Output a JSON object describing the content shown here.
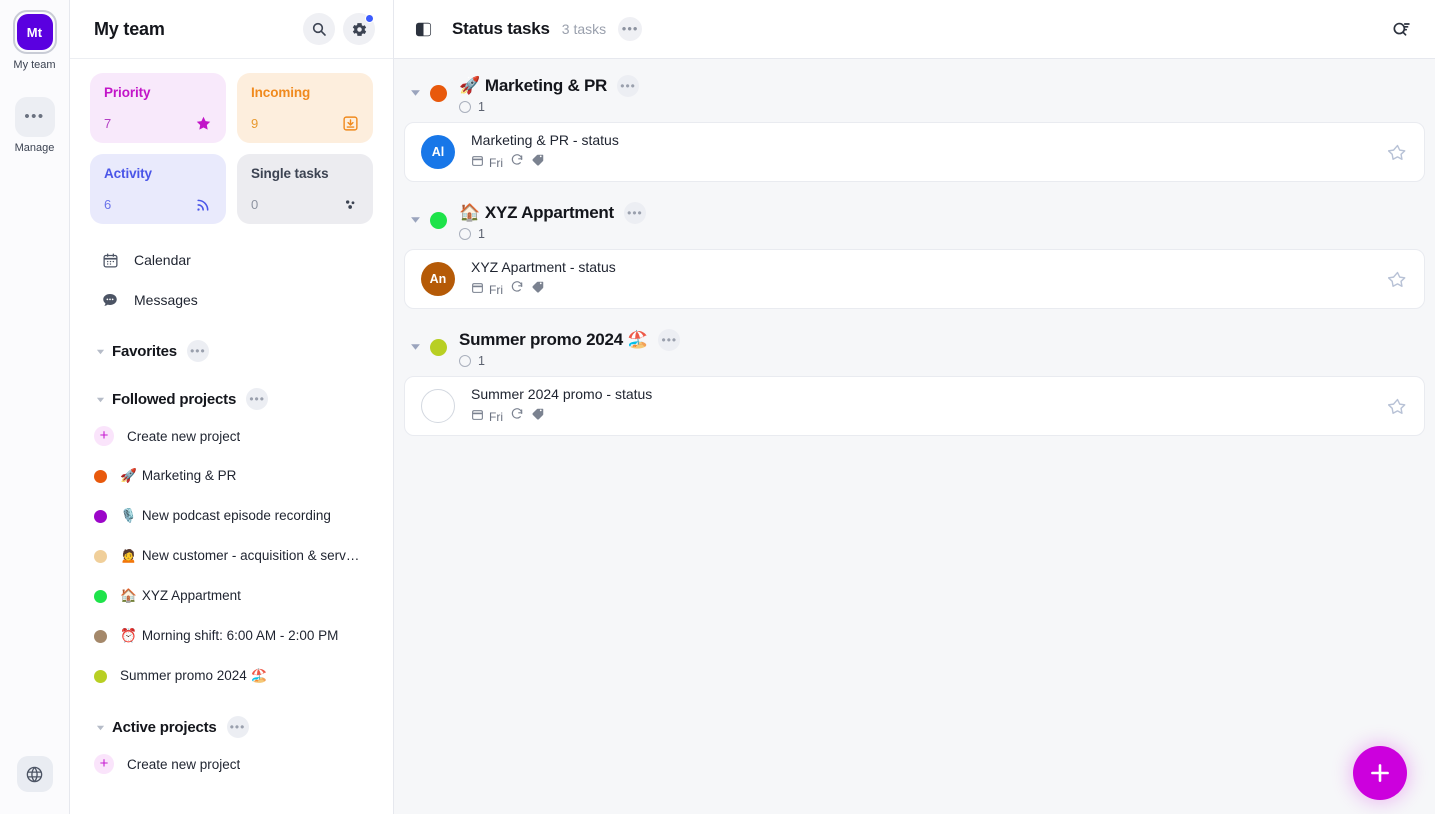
{
  "rail": {
    "workspace": {
      "initials": "Mt",
      "label": "My team",
      "color": "#5a00e0"
    },
    "manage": {
      "label": "Manage",
      "icon": "more-horizontal-icon"
    },
    "bottom": {
      "icon": "globe-icon"
    }
  },
  "sidebar": {
    "title": "My team",
    "actions": [
      {
        "name": "search-icon",
        "label": "Search"
      },
      {
        "name": "settings-gear-icon",
        "label": "Settings",
        "badge": true,
        "badge_color": "#3b5bfd"
      }
    ],
    "cards": [
      {
        "title": "Priority",
        "count": "7",
        "icon": "star-icon",
        "bg": "#f8e9fb",
        "accent": "#c215c8"
      },
      {
        "title": "Incoming",
        "count": "9",
        "icon": "inbox-download-icon",
        "bg": "#fdeedd",
        "accent": "#f08a1e"
      },
      {
        "title": "Activity",
        "count": "6",
        "icon": "activity-rss-icon",
        "bg": "#e9eafc",
        "accent": "#4a55e8"
      },
      {
        "title": "Single tasks",
        "count": "0",
        "icon": "dots-cluster-icon",
        "bg": "#ececf0",
        "accent": "#3c4352"
      }
    ],
    "nav": [
      {
        "label": "Calendar",
        "icon": "calendar-icon"
      },
      {
        "label": "Messages",
        "icon": "chat-bubble-icon"
      }
    ],
    "sections": [
      {
        "title": "Favorites",
        "expanded": true,
        "items": []
      },
      {
        "title": "Followed projects",
        "expanded": true,
        "items": [
          {
            "label": "Create new project",
            "type": "create"
          },
          {
            "emoji": "🚀",
            "label": "Marketing & PR",
            "color": "#e8590c"
          },
          {
            "emoji": "🎙️",
            "label": "New podcast episode recording",
            "color": "#9c06c9"
          },
          {
            "emoji": "🙍",
            "label": "New customer - acquisition & serv…",
            "color": "#f0cf9a"
          },
          {
            "emoji": "🏠",
            "label": "XYZ Appartment",
            "color": "#1ee34a"
          },
          {
            "emoji": "⏰",
            "label": "Morning shift: 6:00 AM - 2:00 PM",
            "color": "#a4886a"
          },
          {
            "emoji": "🏖️",
            "label": "Summer promo 2024",
            "emoji_after": true,
            "color": "#b8cf23"
          }
        ]
      },
      {
        "title": "Active projects",
        "expanded": true,
        "items": [
          {
            "label": "Create new project",
            "type": "create"
          }
        ]
      }
    ]
  },
  "main": {
    "panel_toggle_icon": "sidebar-toggle-icon",
    "title": "Status tasks",
    "count": "3 tasks",
    "more_icon": "more-horizontal-icon",
    "search_filter_icon": "search-filter-icon",
    "fab": {
      "icon": "plus-icon",
      "color": "#cc00dd"
    },
    "groups": [
      {
        "emoji": "🚀",
        "name": "Marketing & PR",
        "dot_color": "#e8590c",
        "open_count": "1",
        "tasks": [
          {
            "avatar_initials": "Al",
            "avatar_color": "#1877e8",
            "title": "Marketing & PR - status",
            "date": "Fri",
            "icons": [
              "calendar-icon",
              "repeat-icon",
              "tag-icon"
            ],
            "starred": false
          }
        ]
      },
      {
        "emoji": "🏠",
        "name": "XYZ Appartment",
        "dot_color": "#1ee34a",
        "open_count": "1",
        "tasks": [
          {
            "avatar_initials": "An",
            "avatar_color": "#b55a07",
            "title": "XYZ Apartment - status",
            "date": "Fri",
            "icons": [
              "calendar-icon",
              "repeat-icon",
              "tag-icon"
            ],
            "starred": false
          }
        ]
      },
      {
        "emoji": "🏖️",
        "emoji_after": true,
        "name": "Summer promo 2024",
        "dot_color": "#b8cf23",
        "open_count": "1",
        "tasks": [
          {
            "avatar_initials": "",
            "avatar_color": "",
            "title": "Summer 2024 promo - status",
            "date": "Fri",
            "icons": [
              "calendar-icon",
              "repeat-icon",
              "tag-icon"
            ],
            "starred": false
          }
        ]
      }
    ]
  }
}
